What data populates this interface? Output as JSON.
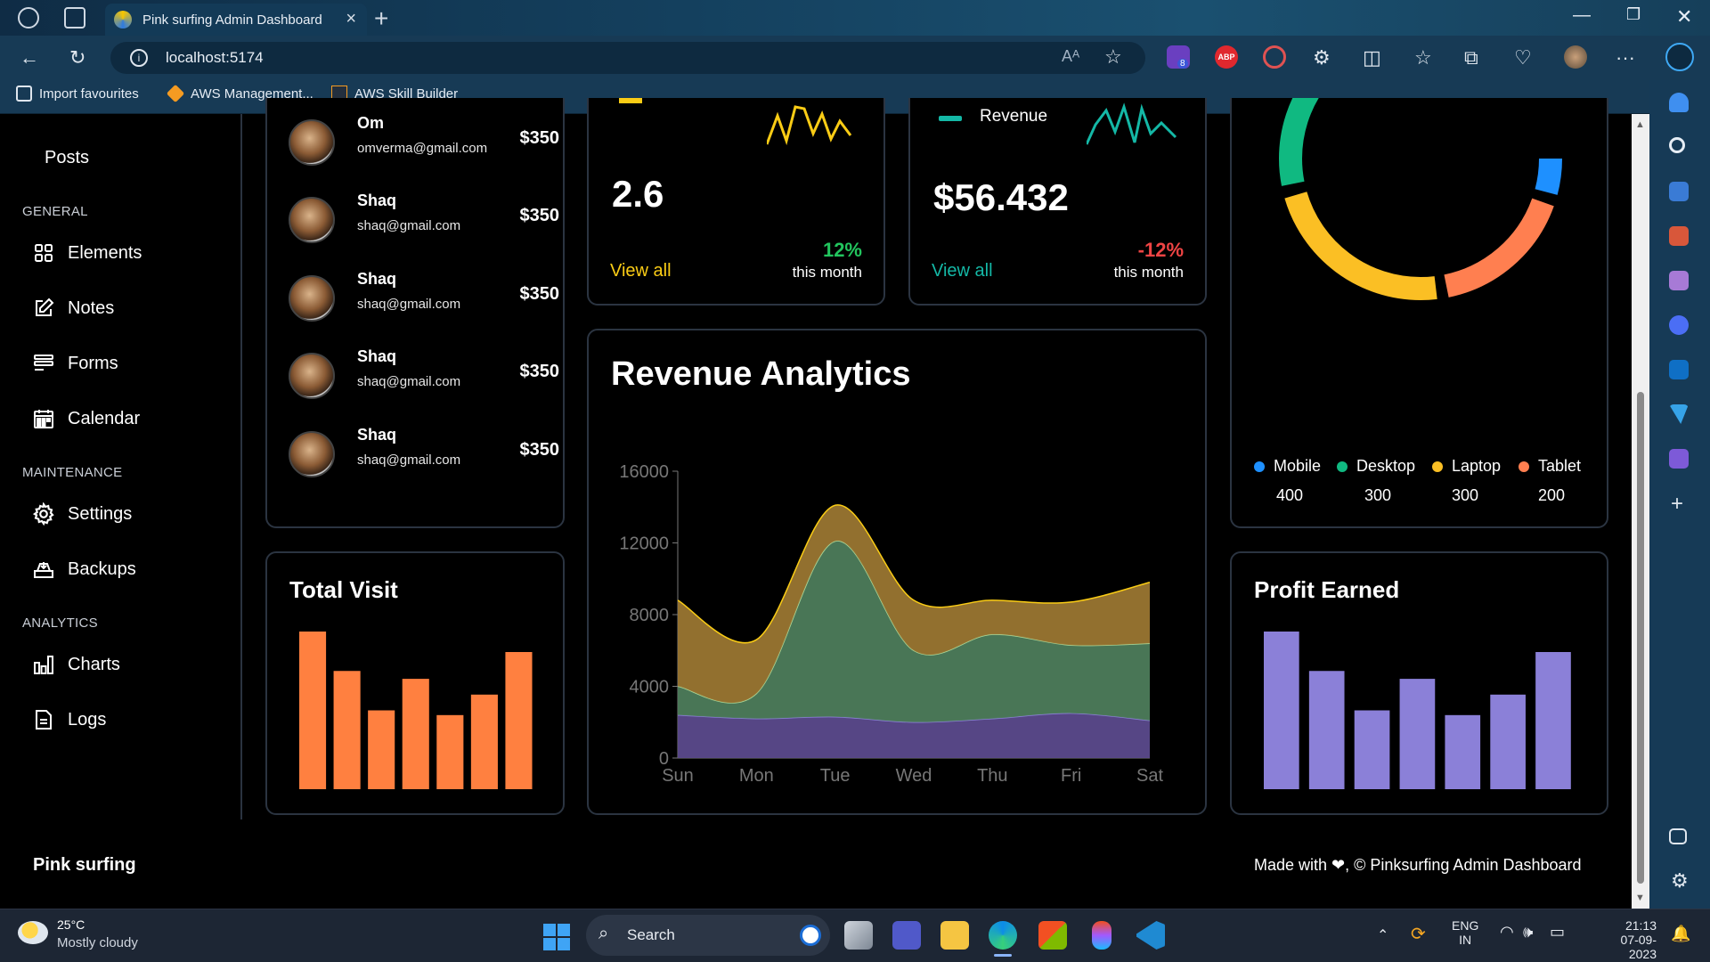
{
  "browser": {
    "tab_title": "Pink surfing Admin Dashboard",
    "url": "localhost:5174",
    "bookmarks": [
      "Import favourites",
      "AWS Management...",
      "AWS Skill Builder"
    ],
    "ext_badge": "8",
    "abp_label": "ABP"
  },
  "sidebar": {
    "top_item": "Posts",
    "general_heading": "GENERAL",
    "general_items": [
      "Elements",
      "Notes",
      "Forms",
      "Calendar"
    ],
    "maintenance_heading": "MAINTENANCE",
    "maintenance_items": [
      "Settings",
      "Backups"
    ],
    "analytics_heading": "ANALYTICS",
    "analytics_items": [
      "Charts",
      "Logs"
    ]
  },
  "customers": [
    {
      "name": "Om",
      "email": "omverma@gmail.com",
      "amount": "$350"
    },
    {
      "name": "Shaq",
      "email": "shaq@gmail.com",
      "amount": "$350"
    },
    {
      "name": "Shaq",
      "email": "shaq@gmail.com",
      "amount": "$350"
    },
    {
      "name": "Shaq",
      "email": "shaq@gmail.com",
      "amount": "$350"
    },
    {
      "name": "Shaq",
      "email": "shaq@gmail.com",
      "amount": "$350"
    }
  ],
  "stat_card_1": {
    "value": "2.6",
    "link": "View all",
    "change": "12%",
    "period": "this month",
    "link_color": "#facc15",
    "change_color": "#22c55e"
  },
  "stat_card_2": {
    "label": "Revenue",
    "value": "$56.432",
    "link": "View all",
    "change": "-12%",
    "period": "this month",
    "link_color": "#14b8a6",
    "change_color": "#ef4444"
  },
  "device_pie": {
    "legend": [
      {
        "label": "Mobile",
        "value": "400",
        "color": "#1e90ff"
      },
      {
        "label": "Desktop",
        "value": "300",
        "color": "#10b981"
      },
      {
        "label": "Laptop",
        "value": "300",
        "color": "#fbbf24"
      },
      {
        "label": "Tablet",
        "value": "200",
        "color": "#ff7f50"
      }
    ]
  },
  "revenue_analytics": {
    "title": "Revenue Analytics",
    "chart_data": {
      "type": "area",
      "stacked": true,
      "categories": [
        "Sun",
        "Mon",
        "Tue",
        "Wed",
        "Thu",
        "Fri",
        "Sat"
      ],
      "series": [
        {
          "values": [
            2400,
            2200,
            2300,
            2000,
            2200,
            2500,
            2100
          ],
          "color": "#5b4a8c"
        },
        {
          "values": [
            1600,
            1400,
            9800,
            4000,
            4700,
            3800,
            4300
          ],
          "color": "#4d7c5b"
        },
        {
          "values": [
            4800,
            3000,
            2000,
            2800,
            1900,
            2400,
            3400
          ],
          "color": "#9a7632"
        }
      ],
      "yticks": [
        0,
        4000,
        8000,
        12000,
        16000
      ],
      "ylim": [
        0,
        16000
      ]
    }
  },
  "total_visit": {
    "title": "Total Visit",
    "chart_data": {
      "type": "bar",
      "values": [
        100,
        75,
        50,
        70,
        47,
        60,
        87
      ],
      "color": "#ff8040"
    }
  },
  "profit_earned": {
    "title": "Profit Earned",
    "chart_data": {
      "type": "bar",
      "values": [
        100,
        75,
        50,
        70,
        47,
        60,
        87
      ],
      "color": "#8b80d8"
    }
  },
  "footer": {
    "brand": "Pink surfing",
    "credit": "Made with ❤, © Pinksurfing Admin Dashboard"
  },
  "taskbar": {
    "weather_temp": "25°C",
    "weather_desc": "Mostly cloudy",
    "search_label": "Search",
    "lang": "ENG",
    "region": "IN",
    "time": "21:13",
    "date": "07-09-2023"
  }
}
